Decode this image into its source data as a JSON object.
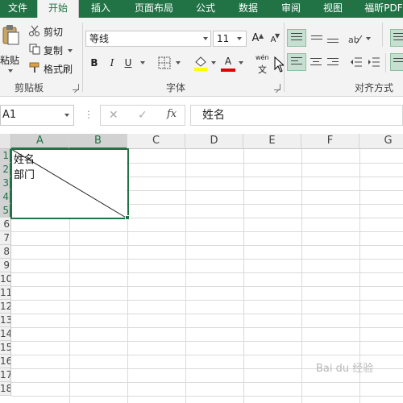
{
  "tabs": [
    "文件",
    "开始",
    "插入",
    "页面布局",
    "公式",
    "数据",
    "审阅",
    "视图",
    "福昕PDF"
  ],
  "active_tab": "开始",
  "clipboard": {
    "paste": "粘贴",
    "cut": "剪切",
    "copy": "复制",
    "format_painter": "格式刷",
    "group_label": "剪贴板"
  },
  "font": {
    "name": "等线",
    "size": "11",
    "grow": "A",
    "shrink": "A",
    "bold": "B",
    "italic": "I",
    "underline": "U",
    "phonetic_top": "wén",
    "phonetic_bottom": "文",
    "font_color_glyph": "A",
    "group_label": "字体",
    "fill_color": "#ffff00",
    "font_color": "#e00000"
  },
  "alignment": {
    "group_label": "对齐方式"
  },
  "formula_bar": {
    "name_box": "A1",
    "cancel": "✕",
    "enter": "✓",
    "fx": "fx",
    "value": "姓名"
  },
  "grid": {
    "columns": [
      "A",
      "B",
      "C",
      "D",
      "E",
      "F",
      "G"
    ],
    "rows": [
      "1",
      "2",
      "3",
      "4",
      "5",
      "6",
      "7",
      "8",
      "9",
      "10",
      "11",
      "12",
      "13",
      "14",
      "15",
      "16",
      "17",
      "18"
    ],
    "cell_line1": "姓名",
    "cell_line2": "部门"
  },
  "watermark": "Bai du 经验",
  "colors": {
    "accent": "#217346",
    "selection": "#217346",
    "align_active": "#c5e0d0"
  }
}
